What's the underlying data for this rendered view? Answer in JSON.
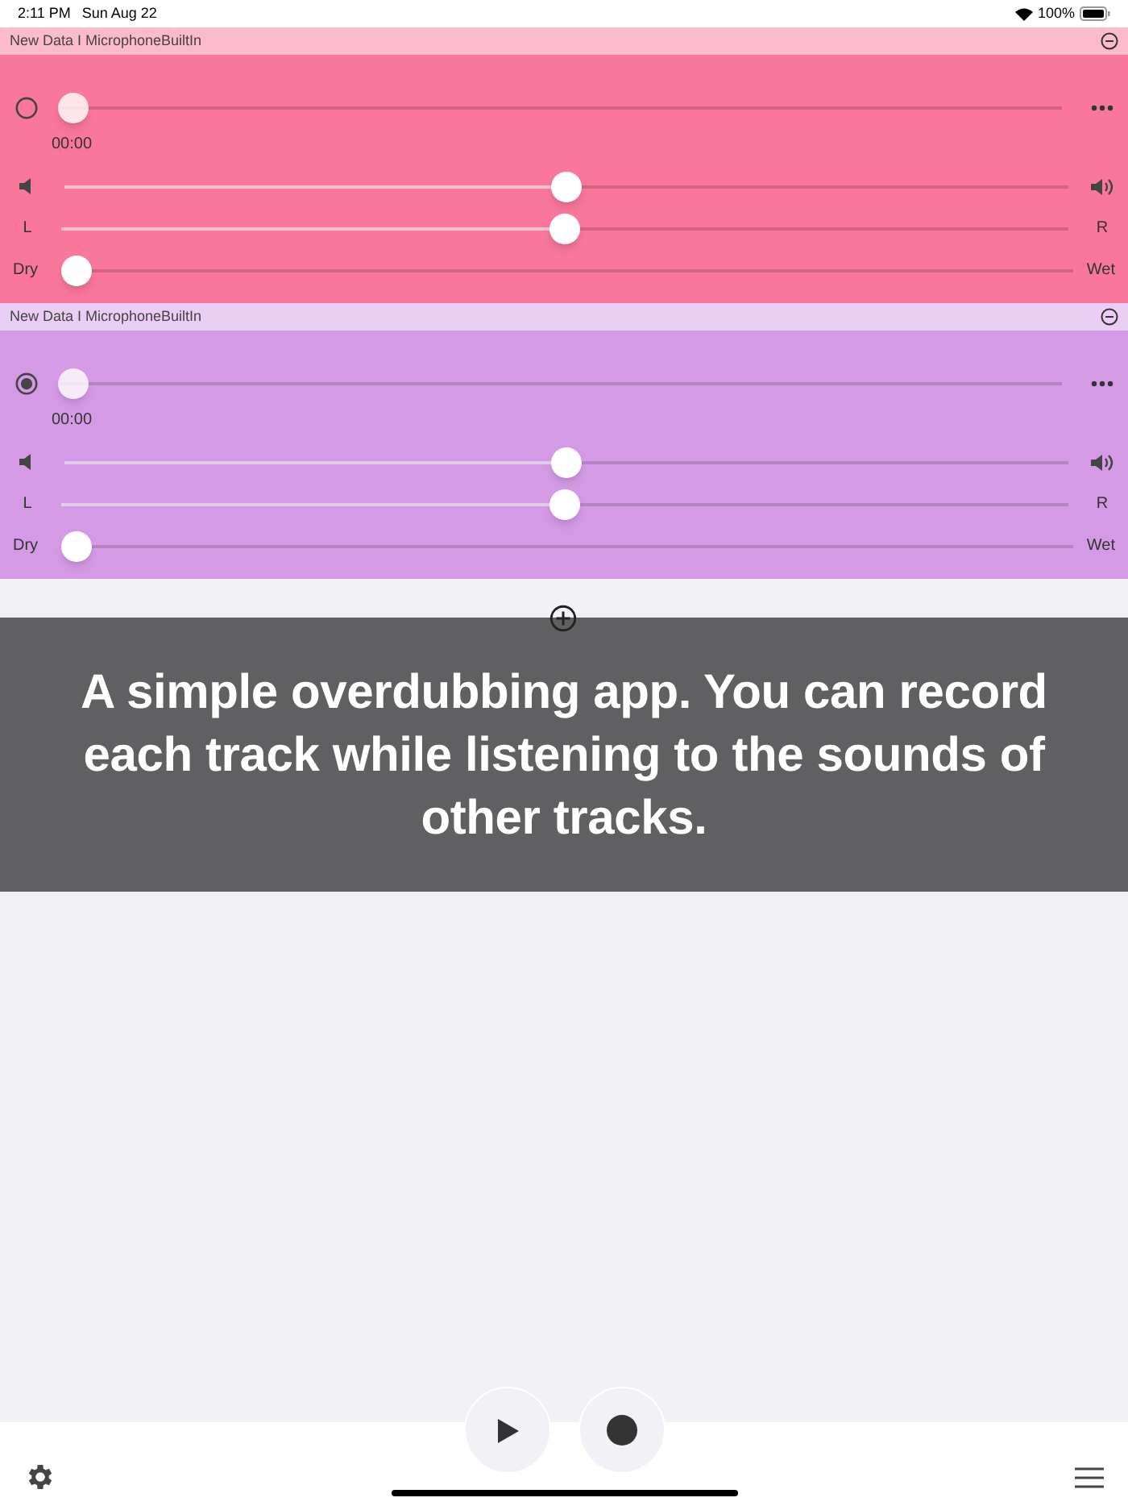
{
  "status_bar": {
    "time": "2:11 PM",
    "date": "Sun Aug 22",
    "battery": "100%"
  },
  "tracks": [
    {
      "name": "New Data I MicrophoneBuiltIn",
      "color": "#f8779b",
      "armed": false,
      "position": {
        "level": 0
      },
      "time": "00:00",
      "volume": {
        "level": 0.5
      },
      "pan": {
        "left": "L",
        "right": "R",
        "level": 0.5
      },
      "mix": {
        "left": "Dry",
        "right": "Wet",
        "level": 0
      }
    },
    {
      "name": "New Data I MicrophoneBuiltIn",
      "color": "#d49ae6",
      "armed": true,
      "position": {
        "level": 0
      },
      "time": "00:00",
      "volume": {
        "level": 0.5
      },
      "pan": {
        "left": "L",
        "right": "R",
        "level": 0.5
      },
      "mix": {
        "left": "Dry",
        "right": "Wet",
        "level": 0
      }
    }
  ],
  "overlay": {
    "caption": "A simple overdubbing app. You can record each track while listening to the sounds of other tracks."
  }
}
